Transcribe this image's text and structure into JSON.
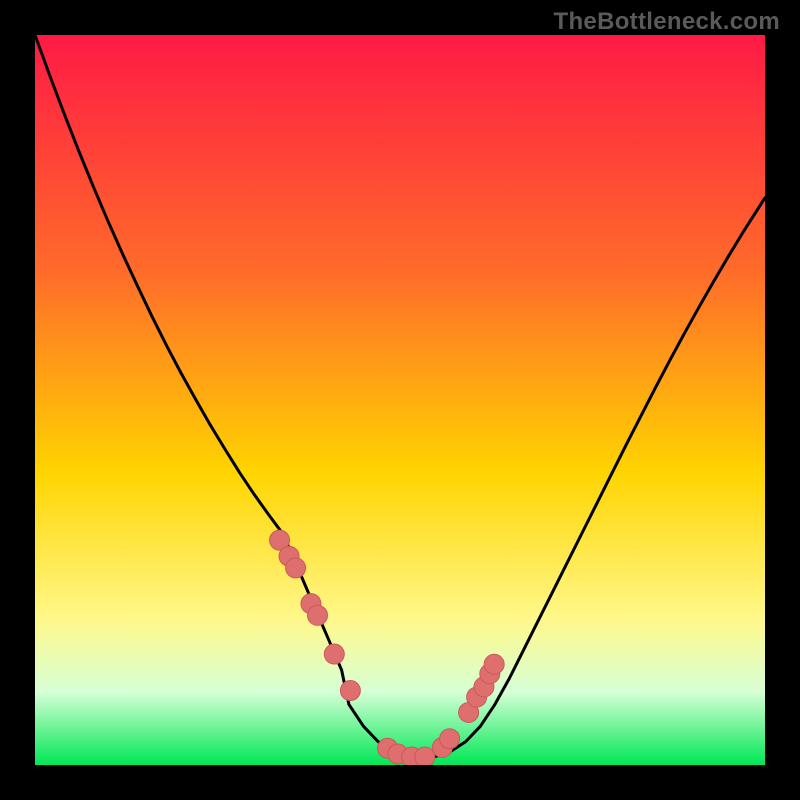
{
  "attribution": "TheBottleneck.com",
  "chart_data": {
    "type": "line",
    "title": "",
    "xlabel": "",
    "ylabel": "",
    "xlim": [
      0,
      100
    ],
    "ylim": [
      0,
      100
    ],
    "curve": {
      "x": [
        0,
        2,
        4,
        6,
        8,
        10,
        12,
        14,
        16,
        18,
        20,
        22,
        24,
        26,
        28,
        30,
        32,
        34,
        36,
        38,
        40,
        42,
        43,
        45,
        47,
        49,
        51,
        53,
        55,
        57,
        59,
        61,
        63,
        65,
        67,
        69,
        71,
        73,
        75,
        77,
        79,
        81,
        83,
        85,
        87,
        89,
        91,
        93,
        95,
        97,
        100
      ],
      "y": [
        100,
        94.5,
        89.2,
        84.1,
        79.2,
        74.5,
        70.0,
        65.7,
        61.5,
        57.5,
        53.7,
        50.1,
        46.6,
        43.3,
        40.1,
        37.1,
        34.3,
        31.6,
        27.0,
        22.3,
        17.7,
        13.0,
        8.3,
        5.3,
        3.2,
        1.9,
        1.2,
        1.0,
        1.2,
        1.9,
        3.2,
        5.3,
        8.3,
        11.9,
        15.9,
        19.9,
        23.9,
        27.9,
        31.9,
        35.9,
        39.9,
        43.9,
        47.8,
        51.7,
        55.5,
        59.2,
        62.8,
        66.3,
        69.7,
        73.0,
        77.7
      ]
    },
    "markers": {
      "x": [
        33.5,
        34.8,
        35.7,
        37.8,
        38.7,
        41.0,
        43.2,
        48.3,
        49.7,
        51.6,
        53.4,
        55.8,
        56.8,
        59.4,
        60.5,
        61.5,
        62.3,
        62.9
      ],
      "y": [
        30.8,
        28.6,
        27.0,
        22.1,
        20.5,
        15.2,
        10.2,
        2.3,
        1.5,
        1.1,
        1.1,
        2.4,
        3.6,
        7.2,
        9.3,
        10.7,
        12.5,
        13.8
      ]
    },
    "legend": false,
    "grid": false,
    "annotations": []
  },
  "colors": {
    "bg_black": "#000000",
    "attribution": "#5a5a5a",
    "gradient_top": "#ff1a45",
    "gradient_mid_high": "#ff6a2a",
    "gradient_mid": "#ffd400",
    "gradient_mid_low": "#fff88a",
    "gradient_band": "#d6ffd6",
    "gradient_bottom": "#00e756",
    "curve_stroke": "#000000",
    "marker_fill": "#df6f6f",
    "marker_stroke": "#c95a5a"
  }
}
